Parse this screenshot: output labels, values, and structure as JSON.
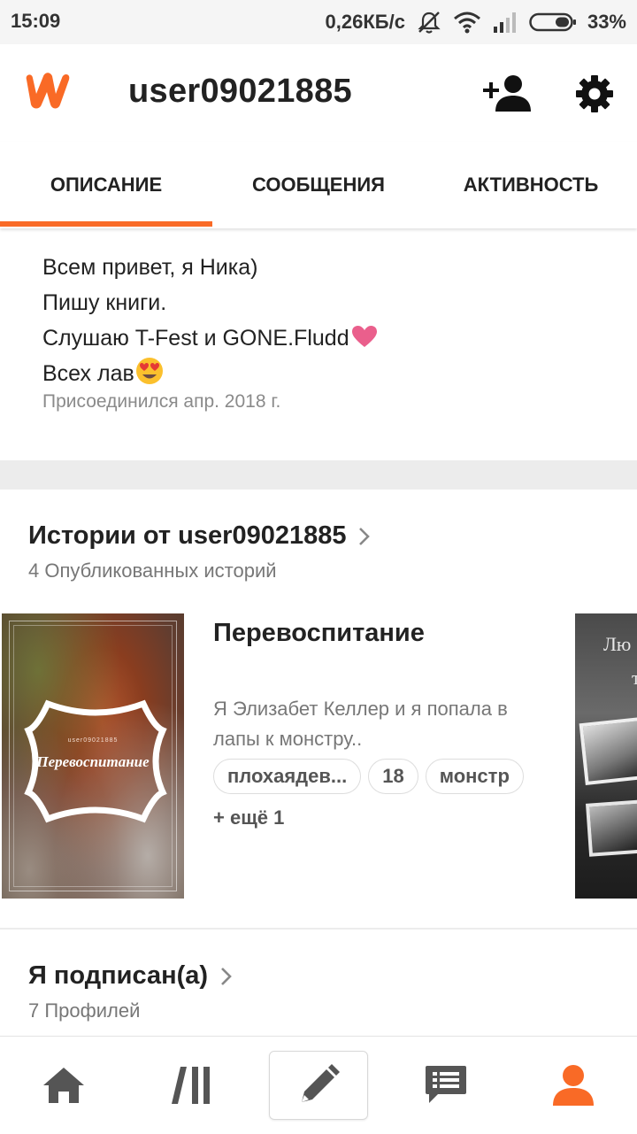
{
  "status_bar": {
    "time": "15:09",
    "network_speed": "0,26КБ/с",
    "battery": "33%",
    "icons": [
      "mute-icon",
      "wifi-icon",
      "signal-icon",
      "battery-icon"
    ]
  },
  "header": {
    "logo": "wattpad-logo",
    "username": "user09021885",
    "add_user_icon": "add-user-icon",
    "settings_icon": "gear-icon"
  },
  "tabs": [
    {
      "label": "ОПИСАНИЕ",
      "active": true
    },
    {
      "label": "СООБЩЕНИЯ",
      "active": false
    },
    {
      "label": "АКТИВНОСТЬ",
      "active": false
    }
  ],
  "profile": {
    "bio_lines": [
      "Всем привет, я Ника)",
      "Пишу книги.",
      "Слушаю T-Fest и GONE.Fludd",
      "Всех лав"
    ],
    "joined": "Присоединился апр. 2018 г."
  },
  "stories": {
    "title": "Истории от user09021885",
    "subtitle": "4 Опубликованных историй",
    "book": {
      "cover_title": "Перевоспитание",
      "cover_author": "user09021885",
      "title": "Перевоспитание",
      "description": "Я Элизабет Келлер и я попала в лапы к монстру..",
      "tags": [
        "плохаядев...",
        "18",
        "монстр"
      ],
      "more": "+ ещё 1"
    },
    "next_cover_text_1": "Лю",
    "next_cover_text_2": "т"
  },
  "following": {
    "title": "Я подписан(а)",
    "subtitle": "7 Профилей"
  },
  "bottom_nav": [
    "home-icon",
    "library-icon",
    "write-icon",
    "messages-icon",
    "profile-icon"
  ],
  "colors": {
    "accent": "#f96a26",
    "text_primary": "#222222",
    "text_secondary": "#777777"
  }
}
